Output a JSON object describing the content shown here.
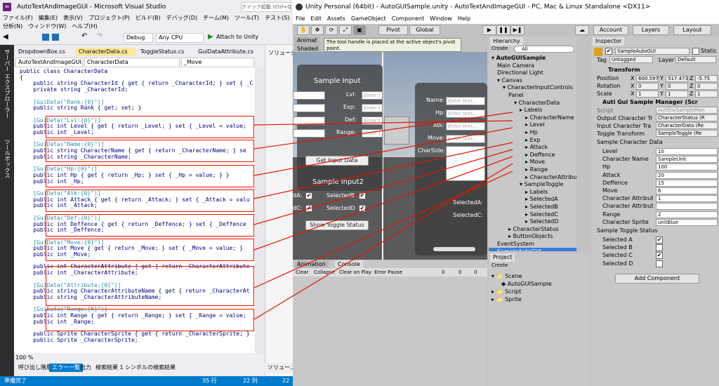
{
  "vs": {
    "title": "AutoTextAndImageGUI - Microsoft Visual Studio",
    "quick_launch": "クイック起動 (Ctrl+Q)",
    "menu": [
      "ファイル(F)",
      "編集(E)",
      "表示(V)",
      "プロジェクト(P)",
      "ビルド(B)",
      "デバッグ(D)",
      "チーム(M)",
      "ツール(T)",
      "テスト(S)",
      "分析(N)",
      "ウィンドウ(W)",
      "ヘルプ(H)"
    ],
    "config": "Debug",
    "platform": "Any CPU",
    "attach": "Attach to Unity",
    "side_tabs": [
      "サーバー エクスプローラー",
      "ツールボックス"
    ],
    "doc_tabs": [
      "DropdownBox.cs",
      "CharacterData.cs",
      "ToggleStatus.cs",
      "GuiDataAttribute.cs"
    ],
    "nav": [
      "AutoTextAndImageGUI.CShi",
      "CharacterData",
      "_Move"
    ],
    "code": [
      "public class CharacterData",
      "{",
      "    public string CharacterId { get { return _CharacterId; } set { _C",
      "    private string _CharacterId;",
      "",
      "    [GuiData(\"Rank:{0}\")]",
      "    public string Rank { get; set; }",
      "",
      "    [GuiData(\"Lvl:{0}\")]",
      "    public int Level { get { return _Level; } set { _Level = value;",
      "    public int _Level;",
      "",
      "    [GuiData(\"Name:{0}\")]",
      "    public string CharacterName { get { return _CharacterName; } se",
      "    public string _CharacterName;",
      "",
      "    [GuiData(\"Hp:{0}\")]",
      "    public int Hp { get { return _Hp; } set { _Hp = value; } }",
      "    public int _Hp;",
      "",
      "    [GuiData(\"Atk:{0}\")]",
      "    public int Attack { get { return _Attack; } set { _Attack = valu",
      "    public int _Attack;",
      "",
      "    [GuiData(\"Def:{0}\")]",
      "    public int Deffence { get { return _Deffence; } set { _Deffence",
      "    public int _Deffence;",
      "",
      "    [GuiData(\"Move:{0}\")]",
      "    public int Move { get { return _Move; } set { _Move = value; }",
      "    public int _Move;",
      "",
      "    public int CharacterAttribute { get { return _CharacterAttribute",
      "    public int _CharacterAttribute;",
      "",
      "    [GuiData(\"Attribute:{0}\")]",
      "    public string CharacterAttributeName { get { return _CharacterAt",
      "    public string _CharacterAttributeName;",
      "",
      "    [GuiData(\"Range:{0}\")]",
      "    public int Range { get { return _Range; } set { _Range = value;",
      "    public int _Range;",
      "",
      "    public Sprite CharacterSprite { get { return _CharacterSprite; }",
      "    public Sprite _CharacterSprite;"
    ],
    "zoom": "100 %",
    "solution_label": "ソリューション",
    "bottom_tabs": [
      "呼び出し階層",
      "エラー一覧",
      "出力",
      "検索結果 1",
      "シンボルの検索結果"
    ],
    "solution_tab": "ソリュー...",
    "status": {
      "ready": "準備完了",
      "line": "35 行",
      "col": "22 列",
      "ch": "22"
    }
  },
  "unity": {
    "title": "Unity Personal (64bit) - AutoGUISample.unity - AutoTextAndImageGUI - PC, Mac & Linux Standalone <DX11>",
    "menu": [
      "File",
      "Edit",
      "Assets",
      "GameObject",
      "Component",
      "Window",
      "Help"
    ],
    "pivot": "Pivot",
    "global": "Global",
    "account": "Account",
    "layers": "Layers",
    "layout": "Layout",
    "scene_tabs": [
      "Animat",
      "Shaded"
    ],
    "tooltip": "The tool handle is placed at the active object's pivot point.",
    "sample_input": {
      "title": "Sample Input",
      "labels": [
        "Lvl:",
        "Exp:",
        "Def:",
        "Range:"
      ],
      "placeholder": "Enter t",
      "button": "Get Input Data"
    },
    "right_panel": {
      "labels": [
        "Name:",
        "Hp:",
        "Atk:",
        "Move:",
        "CharSide:"
      ],
      "placeholder": "Enter text..."
    },
    "sample_input2": {
      "title": "Sample Input2",
      "items": [
        "dA:",
        "SelectedB",
        "dC:",
        "SelectedD"
      ],
      "button": "Show Toggle Status",
      "right_item": "SelectedA:",
      "right_item2": "SelectedC:"
    },
    "hierarchy": {
      "tab": "Hierarchy",
      "create": "Create",
      "search": "All",
      "rows": [
        "AutoGUISample",
        "Main Camera",
        "Directional Light",
        "Canvas",
        "CharacterInputControls",
        "Panel",
        "CharacterData",
        "Labels",
        "CharacterName",
        "Level",
        "Hp",
        "Exp",
        "Attack",
        "Deffence",
        "Move",
        "Range",
        "CharacterAttribute",
        "SampleToggle",
        "Labels",
        "SelectedA",
        "SelectedB",
        "SelectedC",
        "SelectedD",
        "CharacterStatus",
        "ButtonObjects",
        "EventSystem",
        "SampleAutoGUI"
      ]
    },
    "console": {
      "tabs": [
        "Animation",
        "Console"
      ],
      "buttons": [
        "Clear",
        "Collapse",
        "Clear on Play",
        "Error Pause"
      ],
      "counts": [
        "0",
        "0",
        "0"
      ]
    },
    "project": {
      "tab": "Project",
      "create": "Create",
      "rows": [
        "Scene",
        "AutoGUISample",
        "Script",
        "Sprite"
      ]
    },
    "inspector": {
      "tab": "Inspector",
      "name": "SampleAutoGUI",
      "static": "Static",
      "tag_label": "Tag",
      "tag": "Untagged",
      "layer_label": "Layer",
      "layer": "Default",
      "transform": "Transform",
      "position": [
        "Position",
        "X",
        "600.597",
        "Y",
        "517.473",
        "Z",
        "-5.75"
      ],
      "rotation": [
        "Rotation",
        "X",
        "0",
        "Y",
        "0",
        "Z",
        "0"
      ],
      "scale": [
        "Scale",
        "X",
        "1",
        "Y",
        "1",
        "Z",
        "1"
      ],
      "component": "Auti Gui Sample Manager (Scr",
      "script_label": "Script",
      "script": "AutiGuiSampleMan",
      "output_label": "Output Character Tr",
      "output": "CharacterStatus (R",
      "input_label": "Input Character Tra",
      "input": "CharacterData (Re",
      "toggle_label": "Toggle Transform",
      "toggle": "SampleToggle (Re",
      "sample_char": "Sample Character Data",
      "fields": [
        [
          "Level",
          "10"
        ],
        [
          "Character Name",
          "SampleUnit"
        ],
        [
          "Hp",
          "100"
        ],
        [
          "Attack",
          "20"
        ],
        [
          "Deffence",
          "15"
        ],
        [
          "Move",
          "6"
        ],
        [
          "Character Attribut",
          "1"
        ],
        [
          "Character Attribut",
          ""
        ],
        [
          "Range",
          "2"
        ],
        [
          "Character Sprite",
          "unitBlue"
        ]
      ],
      "sample_toggle": "Sample Toggle Status",
      "toggles": [
        [
          "Selected A",
          true
        ],
        [
          "Selected B",
          false
        ],
        [
          "Selected C",
          true
        ],
        [
          "Selected D",
          false
        ]
      ],
      "add_component": "Add Component"
    }
  }
}
